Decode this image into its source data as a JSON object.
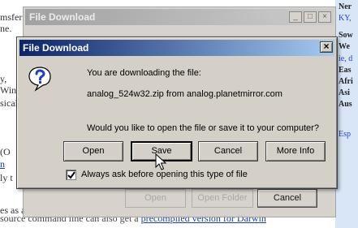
{
  "background_page": {
    "left_fragments": [
      "msfer",
      "ne.",
      "y,",
      "Wind",
      "sicall",
      "(O",
      "n",
      "ly t",
      "es as a"
    ],
    "right_fragments": [
      "Ner",
      "KY,",
      "Sow",
      "We",
      "ie, d",
      "Eas",
      "Afri",
      "Asi",
      "Aus",
      "Esp"
    ],
    "bottom_text": "source command line can also get a",
    "bottom_link": "precompiled version for Darwin"
  },
  "back_window": {
    "title": "File Download",
    "controls": [
      "_",
      "□",
      "×"
    ],
    "buttons": {
      "open": "Open",
      "open_folder": "Open Folder",
      "cancel": "Cancel"
    }
  },
  "dialog": {
    "title": "File Download",
    "close": "×",
    "downloading_text": "You are downloading the file:",
    "file_text": "analog_524w32.zip from analog.planetmirror.com",
    "question": "Would you like to open the file or save it to your computer?",
    "buttons": {
      "open": "Open",
      "save": "Save",
      "cancel": "Cancel",
      "more_info": "More Info"
    },
    "checkbox_label": "Always ask before opening this type of file",
    "checkbox_checked": true
  },
  "colors": {
    "title_active_start": "#0a246a",
    "title_active_end": "#a6caf0",
    "dialog_face": "#d4d0c8"
  }
}
